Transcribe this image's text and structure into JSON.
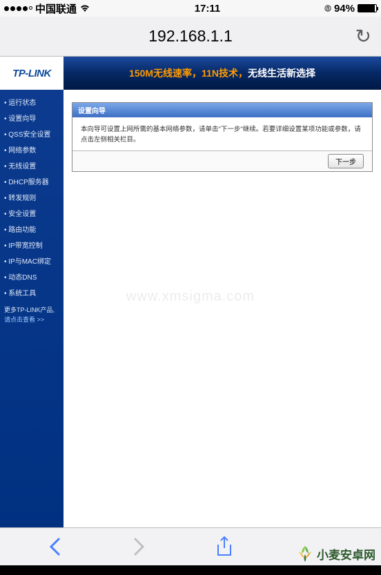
{
  "status": {
    "carrier": "中国联通",
    "time": "17:11",
    "battery_pct": "94%"
  },
  "browser": {
    "url": "192.168.1.1",
    "reload_glyph": "↻"
  },
  "router": {
    "logo": "TP-LINK",
    "banner_orange": "150M无线速率，11N技术，",
    "banner_white": "无线生活新选择",
    "nav": [
      "运行状态",
      "设置向导",
      "QSS安全设置",
      "网络参数",
      "无线设置",
      "DHCP服务器",
      "转发规则",
      "安全设置",
      "路由功能",
      "IP带宽控制",
      "IP与MAC绑定",
      "动态DNS",
      "系统工具"
    ],
    "promo_line1": "更多TP-LINK产品,",
    "promo_line2": "请点击查看 >>",
    "wizard": {
      "title": "设置向导",
      "body": "本向导可设置上网所需的基本网络参数，请单击\"下一步\"继续。若要详细设置某项功能或参数，请点击左侧相关栏目。",
      "next": "下一步"
    }
  },
  "watermark_center": "www.xmsigma.com",
  "watermark_corner": "小麦安卓网"
}
